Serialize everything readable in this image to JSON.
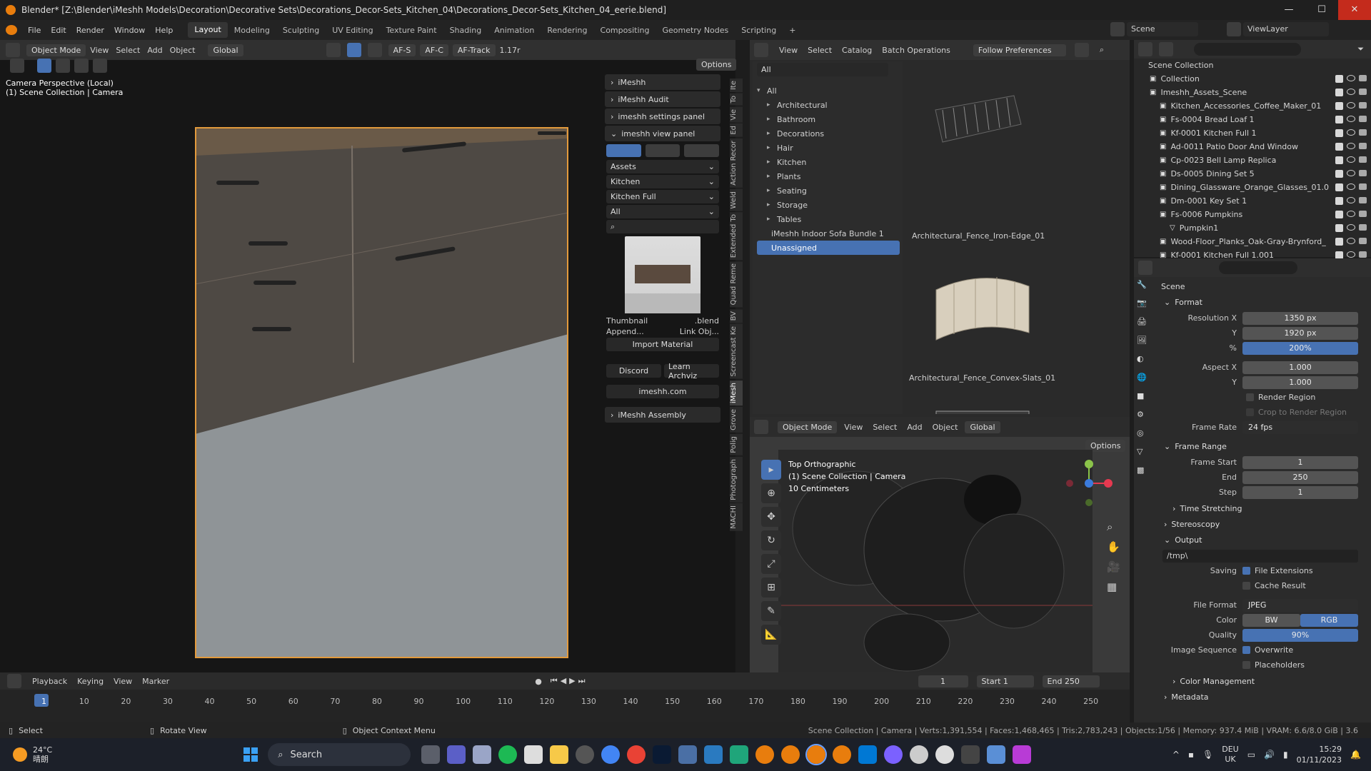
{
  "window": {
    "title": "Blender* [Z:\\Blender\\iMeshh Models\\Decoration\\Decorative Sets\\Decorations_Decor-Sets_Kitchen_04\\Decorations_Decor-Sets_Kitchen_04_eerie.blend]",
    "min": "—",
    "max": "☐",
    "close": "✕"
  },
  "menu": [
    "File",
    "Edit",
    "Render",
    "Window",
    "Help"
  ],
  "workspaces": [
    "Layout",
    "Modeling",
    "Sculpting",
    "UV Editing",
    "Texture Paint",
    "Shading",
    "Animation",
    "Rendering",
    "Compositing",
    "Geometry Nodes",
    "Scripting",
    "+"
  ],
  "scene_field": "Scene",
  "viewlayer_field": "ViewLayer",
  "viewport_header": {
    "mode": "Object Mode",
    "menus": [
      "View",
      "Select",
      "Add",
      "Object"
    ],
    "orient": "Global",
    "af_s": "AF-S",
    "af_c": "AF-C",
    "af_track": "AF-Track",
    "focal": "1.17r",
    "options": "Options"
  },
  "viewport_overlay": {
    "line1": "Camera Perspective (Local)",
    "line2": "(1) Scene Collection | Camera"
  },
  "vtabs_left": [
    "Ite",
    "To",
    "Vie",
    "Ed",
    "Action Recor",
    "Weld",
    "Extended To",
    "Quad Reme",
    "BV",
    "Screencast Ke",
    "iMesh",
    "Grove",
    "Polig",
    "Photograph",
    "MACHI"
  ],
  "imeshh": {
    "panels": [
      "iMeshh",
      "iMeshh Audit",
      "imeshh settings panel",
      "imeshh view panel"
    ],
    "dropdowns": [
      "Assets",
      "Kitchen",
      "Kitchen Full",
      "All"
    ],
    "thumbnail": "Thumbnail",
    "blend": ".blend",
    "append": "Append...",
    "link": "Link Obj...",
    "import": "Import Material",
    "discord": "Discord",
    "learn": "Learn Archviz",
    "site": "imeshh.com",
    "assembly": "iMeshh Assembly"
  },
  "browser": {
    "menus": [
      "View",
      "Select",
      "Catalog",
      "Batch Operations"
    ],
    "follow": "Follow Preferences",
    "filter": "All",
    "tree": [
      {
        "t": "All",
        "open": true,
        "lvl": 0
      },
      {
        "t": "Architectural",
        "lvl": 1
      },
      {
        "t": "Bathroom",
        "lvl": 1
      },
      {
        "t": "Decorations",
        "lvl": 1
      },
      {
        "t": "Hair",
        "lvl": 1
      },
      {
        "t": "Kitchen",
        "lvl": 1
      },
      {
        "t": "Plants",
        "lvl": 1
      },
      {
        "t": "Seating",
        "lvl": 1
      },
      {
        "t": "Storage",
        "lvl": 1
      },
      {
        "t": "Tables",
        "lvl": 1
      }
    ],
    "bundle": "iMeshh Indoor Sofa Bundle 1",
    "unassigned": "Unassigned",
    "assets": [
      "Architectural_Fence_Iron-Edge_01",
      "Architectural_Fence_Convex-Slats_01"
    ]
  },
  "viewport2": {
    "mode": "Object Mode",
    "menus": [
      "View",
      "Select",
      "Add",
      "Object"
    ],
    "orient": "Global",
    "options": "Options",
    "line1": "Top Orthographic",
    "line2": "(1) Scene Collection | Camera",
    "line3": "10 Centimeters"
  },
  "outliner": {
    "root": "Scene Collection",
    "rows": [
      {
        "t": "Collection",
        "lvl": 1
      },
      {
        "t": "Imeshh_Assets_Scene",
        "lvl": 1
      },
      {
        "t": "Kitchen_Accessories_Coffee_Maker_01",
        "lvl": 2
      },
      {
        "t": "Fs-0004 Bread Loaf 1",
        "lvl": 2
      },
      {
        "t": "Kf-0001 Kitchen Full 1",
        "lvl": 2
      },
      {
        "t": "Ad-0011 Patio Door And Window",
        "lvl": 2
      },
      {
        "t": "Cp-0023 Bell Lamp Replica",
        "lvl": 2
      },
      {
        "t": "Ds-0005 Dining Set 5",
        "lvl": 2
      },
      {
        "t": "Dining_Glassware_Orange_Glasses_01.0",
        "lvl": 2
      },
      {
        "t": "Dm-0001 Key Set 1",
        "lvl": 2
      },
      {
        "t": "Fs-0006 Pumpkins",
        "lvl": 2
      },
      {
        "t": "Pumpkin1",
        "lvl": 3
      },
      {
        "t": "Wood-Floor_Planks_Oak-Gray-Brynford_",
        "lvl": 2
      },
      {
        "t": "Kf-0001 Kitchen Full 1.001",
        "lvl": 2
      }
    ]
  },
  "props": {
    "scene": "Scene",
    "format": "Format",
    "res_x_l": "Resolution X",
    "res_x": "1350 px",
    "res_y_l": "Y",
    "res_y": "1920 px",
    "pct_l": "%",
    "pct": "200%",
    "asp_x_l": "Aspect X",
    "asp_x": "1.000",
    "asp_y_l": "Y",
    "asp_y": "1.000",
    "render_region": "Render Region",
    "crop": "Crop to Render Region",
    "fr_l": "Frame Rate",
    "fr": "24 fps",
    "frame_range": "Frame Range",
    "fs_l": "Frame Start",
    "fs": "1",
    "end_l": "End",
    "end": "250",
    "step_l": "Step",
    "step": "1",
    "time_stretch": "Time Stretching",
    "stereo": "Stereoscopy",
    "output": "Output",
    "path": "/tmp\\",
    "saving": "Saving",
    "file_ext": "File Extensions",
    "cache": "Cache Result",
    "ff_l": "File Format",
    "ff": "JPEG",
    "color_l": "Color",
    "bw": "BW",
    "rgb": "RGB",
    "quality_l": "Quality",
    "quality": "90%",
    "imgseq": "Image Sequence",
    "overwrite": "Overwrite",
    "placeholders": "Placeholders",
    "color_mgmt": "Color Management",
    "metadata": "Metadata"
  },
  "timeline": {
    "menus": [
      "Playback",
      "Keying",
      "View",
      "Marker"
    ],
    "current": "1",
    "start_l": "Start",
    "start": "1",
    "end_l": "End",
    "end": "250",
    "ticks": [
      "1",
      "10",
      "20",
      "30",
      "40",
      "50",
      "60",
      "70",
      "80",
      "90",
      "100",
      "110",
      "120",
      "130",
      "140",
      "150",
      "160",
      "170",
      "180",
      "190",
      "200",
      "210",
      "220",
      "230",
      "240",
      "250"
    ]
  },
  "status": {
    "select": "Select",
    "rotate": "Rotate View",
    "context": "Object Context Menu",
    "info": "Scene Collection | Camera | Verts:1,391,554 | Faces:1,468,465 | Tris:2,783,243 | Objects:1/56 | Memory: 937.4 MiB | VRAM: 6.6/8.0 GiB | 3.6"
  },
  "taskbar": {
    "temp": "24°C",
    "weather": "晴朗",
    "search": "Search",
    "lang1": "DEU",
    "lang2": "UK",
    "time": "15:29",
    "date": "01/11/2023"
  }
}
